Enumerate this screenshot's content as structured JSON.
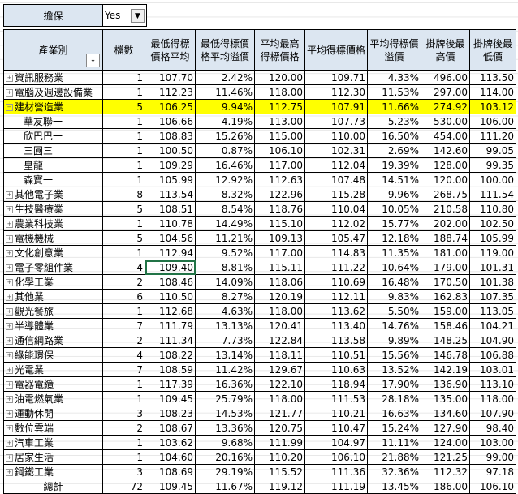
{
  "filter": {
    "label": "擔保",
    "value": "Yes"
  },
  "headers": [
    "產業別",
    "檔數",
    "最低得標價格平均",
    "最低得標價格平均溢價",
    "平均最高得標價格",
    "平均得標價格",
    "平均得標價溢價",
    "掛牌後最高價",
    "掛牌後最低價"
  ],
  "rows": [
    {
      "name": "資訊服務業",
      "type": "group",
      "v": [
        "1",
        "107.70",
        "2.42%",
        "120.00",
        "109.71",
        "4.33%",
        "496.00",
        "113.50"
      ]
    },
    {
      "name": "電腦及週邊設備業",
      "type": "group",
      "v": [
        "1",
        "112.23",
        "11.46%",
        "118.00",
        "112.30",
        "11.53%",
        "297.00",
        "114.00"
      ]
    },
    {
      "name": "建材營造業",
      "type": "expanded",
      "v": [
        "5",
        "106.25",
        "9.94%",
        "112.75",
        "107.91",
        "11.66%",
        "274.92",
        "103.12"
      ]
    },
    {
      "name": "華友聯一",
      "type": "child",
      "v": [
        "1",
        "106.66",
        "4.19%",
        "113.00",
        "107.73",
        "5.23%",
        "530.00",
        "106.00"
      ]
    },
    {
      "name": "欣巴巴一",
      "type": "child",
      "v": [
        "1",
        "108.83",
        "15.26%",
        "115.00",
        "110.00",
        "16.50%",
        "454.00",
        "111.20"
      ]
    },
    {
      "name": "三圓三",
      "type": "child",
      "v": [
        "1",
        "100.50",
        "0.87%",
        "106.10",
        "102.31",
        "2.69%",
        "142.60",
        "99.05"
      ]
    },
    {
      "name": "皇龍一",
      "type": "child",
      "v": [
        "1",
        "109.29",
        "16.46%",
        "117.00",
        "112.04",
        "19.39%",
        "128.00",
        "99.35"
      ]
    },
    {
      "name": "森寶一",
      "type": "child",
      "v": [
        "1",
        "105.99",
        "12.92%",
        "112.63",
        "107.48",
        "14.51%",
        "120.00",
        "100.00"
      ]
    },
    {
      "name": "其他電子業",
      "type": "group",
      "v": [
        "8",
        "113.54",
        "8.32%",
        "122.96",
        "115.28",
        "9.96%",
        "268.75",
        "111.54"
      ]
    },
    {
      "name": "生技醫療業",
      "type": "group",
      "v": [
        "5",
        "108.51",
        "8.54%",
        "118.76",
        "110.04",
        "10.05%",
        "210.58",
        "110.80"
      ]
    },
    {
      "name": "農業科技業",
      "type": "group",
      "v": [
        "1",
        "110.78",
        "14.49%",
        "115.10",
        "112.02",
        "15.77%",
        "202.00",
        "102.50"
      ]
    },
    {
      "name": "電機機械",
      "type": "group",
      "v": [
        "5",
        "104.56",
        "11.21%",
        "109.13",
        "105.47",
        "12.18%",
        "188.74",
        "105.99"
      ]
    },
    {
      "name": "文化創意業",
      "type": "group",
      "v": [
        "1",
        "112.94",
        "9.52%",
        "117.00",
        "114.83",
        "11.35%",
        "181.00",
        "119.00"
      ]
    },
    {
      "name": "電子零組件業",
      "type": "group",
      "v": [
        "4",
        "109.40",
        "8.81%",
        "115.11",
        "111.22",
        "10.64%",
        "179.00",
        "101.31"
      ]
    },
    {
      "name": "化學工業",
      "type": "group",
      "v": [
        "2",
        "108.46",
        "14.09%",
        "118.06",
        "110.69",
        "16.48%",
        "170.50",
        "101.38"
      ]
    },
    {
      "name": "其他業",
      "type": "group",
      "v": [
        "6",
        "110.50",
        "8.27%",
        "120.19",
        "112.11",
        "9.83%",
        "162.83",
        "107.35"
      ]
    },
    {
      "name": "觀光餐旅",
      "type": "group",
      "v": [
        "1",
        "112.68",
        "4.63%",
        "118.00",
        "113.62",
        "5.50%",
        "159.00",
        "113.05"
      ]
    },
    {
      "name": "半導體業",
      "type": "group",
      "v": [
        "7",
        "111.79",
        "13.13%",
        "120.41",
        "113.40",
        "14.76%",
        "158.46",
        "104.21"
      ]
    },
    {
      "name": "通信網路業",
      "type": "group",
      "v": [
        "2",
        "111.34",
        "7.73%",
        "122.84",
        "113.58",
        "9.89%",
        "148.25",
        "104.90"
      ]
    },
    {
      "name": "綠能環保",
      "type": "group",
      "v": [
        "4",
        "108.22",
        "13.14%",
        "118.11",
        "110.51",
        "15.56%",
        "146.78",
        "106.88"
      ]
    },
    {
      "name": "光電業",
      "type": "group",
      "v": [
        "7",
        "108.59",
        "11.42%",
        "129.67",
        "110.63",
        "13.52%",
        "142.19",
        "103.01"
      ]
    },
    {
      "name": "電器電纜",
      "type": "group",
      "v": [
        "1",
        "117.39",
        "16.36%",
        "122.10",
        "118.94",
        "17.90%",
        "136.90",
        "113.10"
      ]
    },
    {
      "name": "油電燃氣業",
      "type": "group",
      "v": [
        "1",
        "109.45",
        "25.79%",
        "118.00",
        "111.53",
        "28.18%",
        "135.00",
        "118.00"
      ]
    },
    {
      "name": "運動休閒",
      "type": "group",
      "v": [
        "3",
        "108.23",
        "14.53%",
        "121.77",
        "110.21",
        "16.63%",
        "134.60",
        "107.90"
      ]
    },
    {
      "name": "數位雲端",
      "type": "group",
      "v": [
        "2",
        "108.67",
        "13.36%",
        "120.75",
        "110.47",
        "15.24%",
        "127.90",
        "98.40"
      ]
    },
    {
      "name": "汽車工業",
      "type": "group",
      "v": [
        "1",
        "103.62",
        "9.68%",
        "111.99",
        "104.97",
        "11.11%",
        "124.00",
        "103.00"
      ]
    },
    {
      "name": "居家生活",
      "type": "group",
      "v": [
        "1",
        "104.60",
        "20.16%",
        "110.20",
        "106.10",
        "21.88%",
        "121.25",
        "99.00"
      ]
    },
    {
      "name": "鋼鐵工業",
      "type": "group",
      "v": [
        "3",
        "108.69",
        "29.19%",
        "115.52",
        "111.36",
        "32.36%",
        "112.32",
        "97.18"
      ]
    },
    {
      "name": "總計",
      "type": "total",
      "v": [
        "72",
        "109.45",
        "11.67%",
        "119.12",
        "111.19",
        "13.45%",
        "186.00",
        "106.10"
      ]
    }
  ],
  "highlight_color": "#ffff00",
  "header_color": "#dce6f1"
}
